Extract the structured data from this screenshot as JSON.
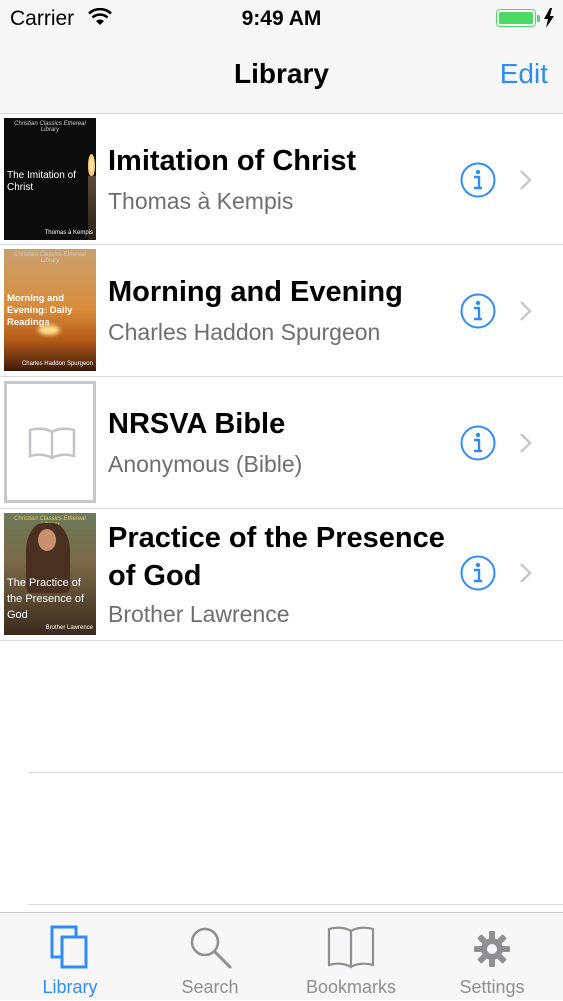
{
  "status_bar": {
    "carrier": "Carrier",
    "time": "9:49 AM"
  },
  "nav": {
    "title": "Library",
    "edit_label": "Edit"
  },
  "books": [
    {
      "title": "Imitation of Christ",
      "author": "Thomas à Kempis",
      "cover": {
        "series": "Christian Classics Ethereal Library",
        "title": "The Imitation of Christ",
        "author": "Thomas à Kempis"
      }
    },
    {
      "title": "Morning and Evening",
      "author": "Charles Haddon Spurgeon",
      "cover": {
        "series": "Christian Classics Ethereal Library",
        "title": "Morning and Evening: Daily Readings",
        "author": "Charles Haddon Spurgeon"
      }
    },
    {
      "title": "NRSVA Bible",
      "author": "Anonymous (Bible)",
      "cover": {
        "icon": "book-icon"
      }
    },
    {
      "title": "Practice of the Presence of God",
      "author": "Brother Lawrence",
      "cover": {
        "series": "Christian Classics Ethereal Library",
        "title": "The Practice of the Presence of God",
        "author": "Brother Lawrence"
      }
    }
  ],
  "tabs": [
    {
      "label": "Library",
      "icon": "library-icon",
      "active": true
    },
    {
      "label": "Search",
      "icon": "search-icon",
      "active": false
    },
    {
      "label": "Bookmarks",
      "icon": "bookmarks-icon",
      "active": false
    },
    {
      "label": "Settings",
      "icon": "gear-icon",
      "active": false
    }
  ],
  "colors": {
    "accent": "#2e8df5",
    "inactive": "#8e8e93",
    "battery": "#4cd964"
  }
}
